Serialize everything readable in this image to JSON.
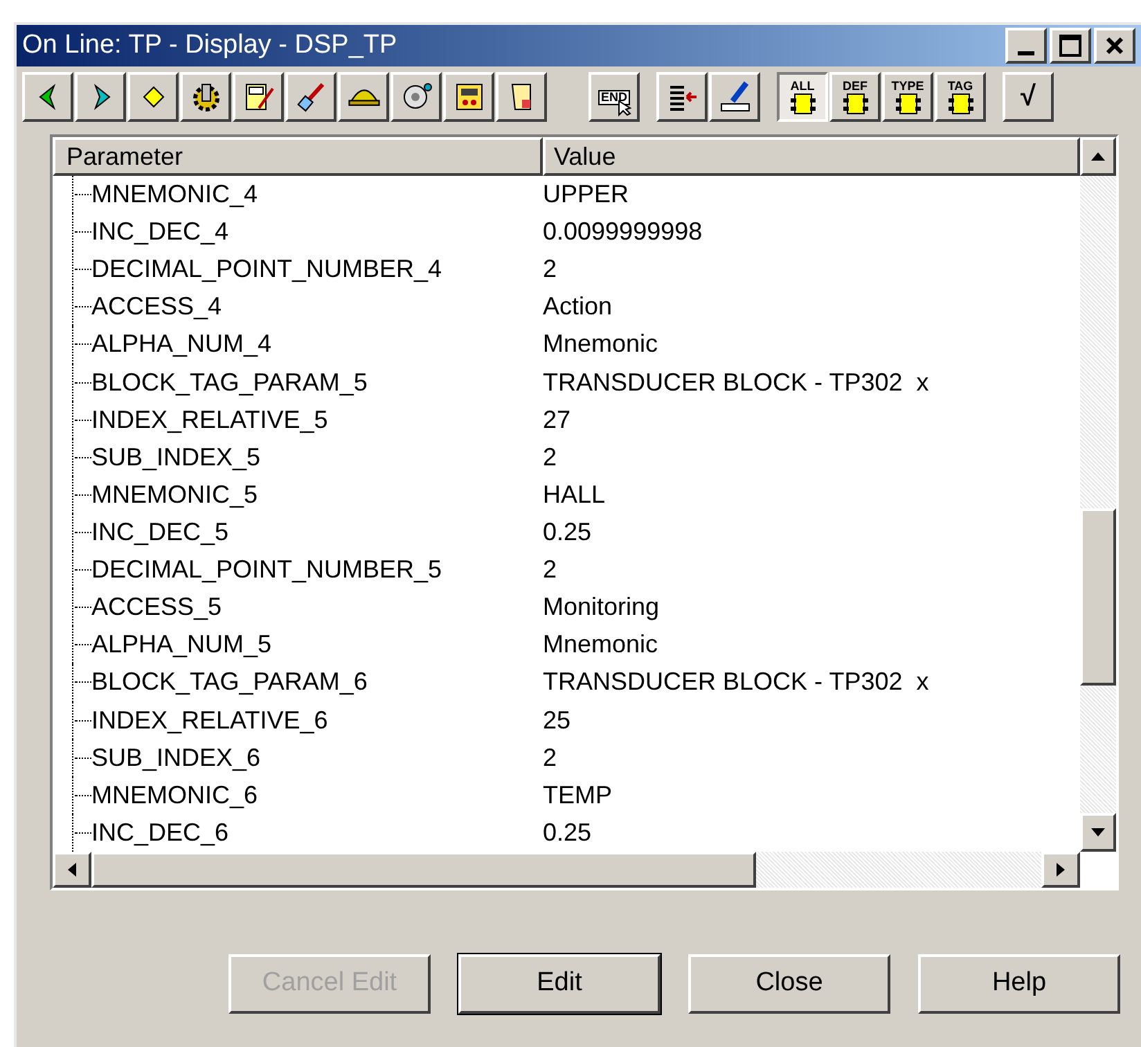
{
  "window": {
    "title": "On Line: TP - Display - DSP_TP"
  },
  "toolbar": [
    {
      "items": [
        {
          "kind": "icon"
        },
        {
          "kind": "icon"
        },
        {
          "kind": "icon"
        },
        {
          "kind": "icon"
        },
        {
          "kind": "icon"
        },
        {
          "kind": "icon"
        },
        {
          "kind": "icon"
        },
        {
          "kind": "icon"
        },
        {
          "kind": "icon"
        },
        {
          "kind": "icon"
        }
      ]
    },
    {
      "items": [
        {
          "kind": "label-icon",
          "label": "END"
        }
      ]
    },
    {
      "items": [
        {
          "kind": "icon"
        },
        {
          "kind": "icon"
        }
      ]
    },
    {
      "items": [
        {
          "kind": "tag-icon",
          "label": "ALL",
          "selected": true
        },
        {
          "kind": "tag-icon",
          "label": "DEF",
          "selected": false
        },
        {
          "kind": "tag-icon",
          "label": "TYPE",
          "selected": false
        },
        {
          "kind": "tag-icon",
          "label": "TAG",
          "selected": false
        }
      ]
    },
    {
      "items": [
        {
          "kind": "text",
          "label": "√"
        }
      ]
    }
  ],
  "table": {
    "columns": [
      "Parameter",
      "Value"
    ],
    "rows": [
      {
        "parameter": "MNEMONIC_4",
        "value": "UPPER"
      },
      {
        "parameter": "INC_DEC_4",
        "value": "0.0099999998"
      },
      {
        "parameter": "DECIMAL_POINT_NUMBER_4",
        "value": "2"
      },
      {
        "parameter": "ACCESS_4",
        "value": "Action"
      },
      {
        "parameter": "ALPHA_NUM_4",
        "value": "Mnemonic"
      },
      {
        "parameter": "BLOCK_TAG_PARAM_5",
        "value": "TRANSDUCER BLOCK - TP302  x"
      },
      {
        "parameter": "INDEX_RELATIVE_5",
        "value": "27"
      },
      {
        "parameter": "SUB_INDEX_5",
        "value": "2"
      },
      {
        "parameter": "MNEMONIC_5",
        "value": "HALL"
      },
      {
        "parameter": "INC_DEC_5",
        "value": "0.25"
      },
      {
        "parameter": "DECIMAL_POINT_NUMBER_5",
        "value": "2"
      },
      {
        "parameter": "ACCESS_5",
        "value": "Monitoring"
      },
      {
        "parameter": "ALPHA_NUM_5",
        "value": "Mnemonic"
      },
      {
        "parameter": "BLOCK_TAG_PARAM_6",
        "value": "TRANSDUCER BLOCK - TP302  x"
      },
      {
        "parameter": "INDEX_RELATIVE_6",
        "value": "25"
      },
      {
        "parameter": "SUB_INDEX_6",
        "value": "2"
      },
      {
        "parameter": "MNEMONIC_6",
        "value": "TEMP"
      },
      {
        "parameter": "INC_DEC_6",
        "value": "0.25"
      }
    ]
  },
  "buttons": [
    {
      "label": "Cancel Edit",
      "disabled": true,
      "default": false
    },
    {
      "label": "Edit",
      "disabled": false,
      "default": true
    },
    {
      "label": "Close",
      "disabled": false,
      "default": false
    },
    {
      "label": "Help",
      "disabled": false,
      "default": false
    }
  ]
}
